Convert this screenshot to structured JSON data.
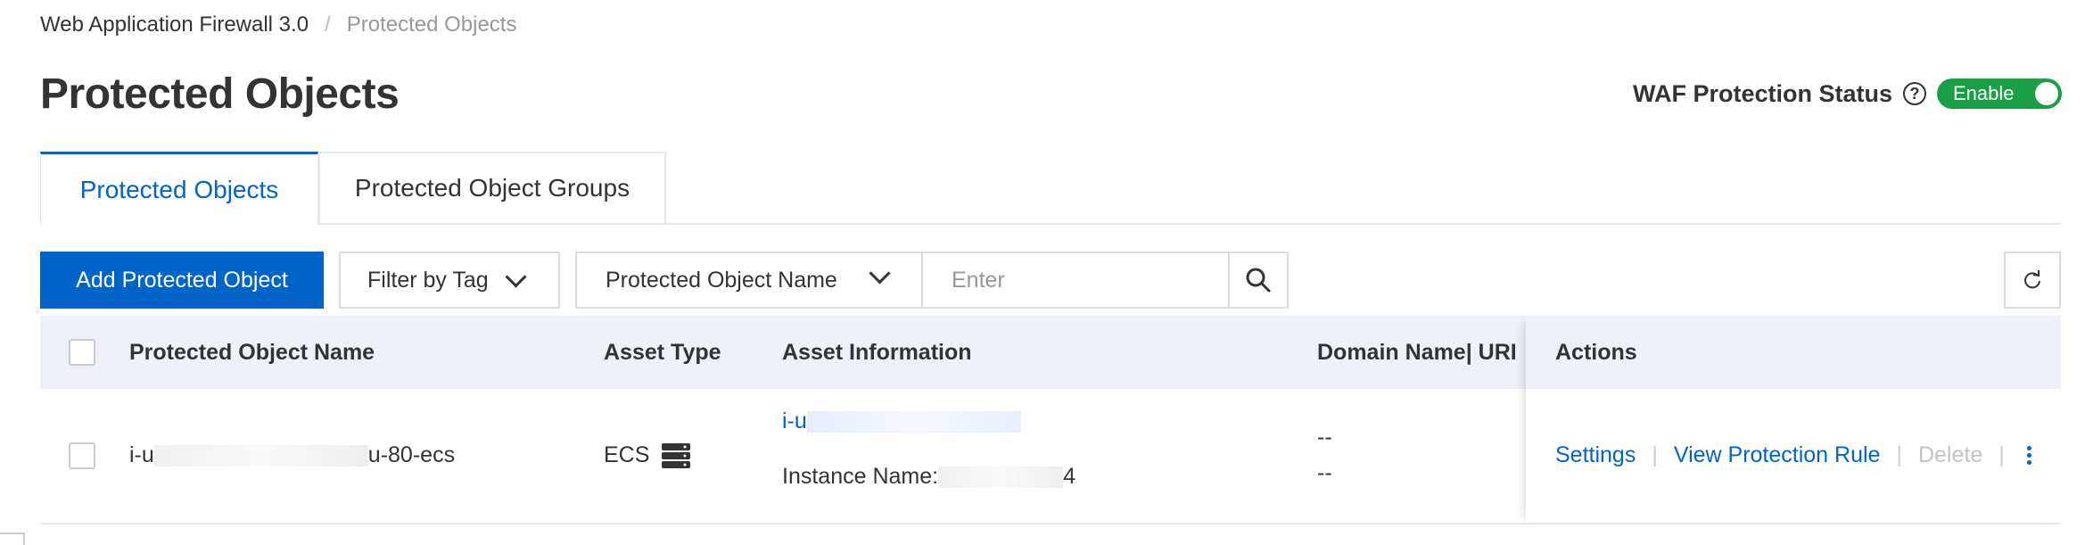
{
  "breadcrumb": {
    "root": "Web Application Firewall 3.0",
    "separator": "/",
    "current": "Protected Objects"
  },
  "page_title": "Protected Objects",
  "waf_status": {
    "label": "WAF Protection Status",
    "help_icon": "question-circle-icon",
    "toggle_label": "Enable",
    "toggle_on": true,
    "toggle_color": "#1a9f46"
  },
  "tabs": [
    {
      "label": "Protected Objects",
      "active": true
    },
    {
      "label": "Protected Object Groups",
      "active": false
    }
  ],
  "toolbar": {
    "add_button": "Add Protected Object",
    "filter_by_tag": "Filter by Tag",
    "search_field_select": "Protected Object Name",
    "search_placeholder": "Enter",
    "search_icon": "search-icon",
    "refresh_icon": "refresh-icon"
  },
  "table": {
    "headers": {
      "name": "Protected Object Name",
      "asset_type": "Asset Type",
      "asset_info": "Asset Information",
      "domain_uri": "Domain Name| URI",
      "actions": "Actions"
    },
    "rows": [
      {
        "name_prefix": "i-u",
        "name_suffix": "u-80-ecs",
        "asset_type": "ECS",
        "asset_type_icon": "server-icon",
        "asset_id_prefix": "i-u",
        "instance_label": "Instance Name:",
        "instance_suffix": "4",
        "domain": "--",
        "uri": "--",
        "actions": {
          "settings": "Settings",
          "view_rule": "View Protection Rule",
          "delete": "Delete",
          "separator": "|"
        }
      }
    ]
  },
  "colors": {
    "accent": "#0064c8",
    "header_bg": "#eef1f8"
  }
}
